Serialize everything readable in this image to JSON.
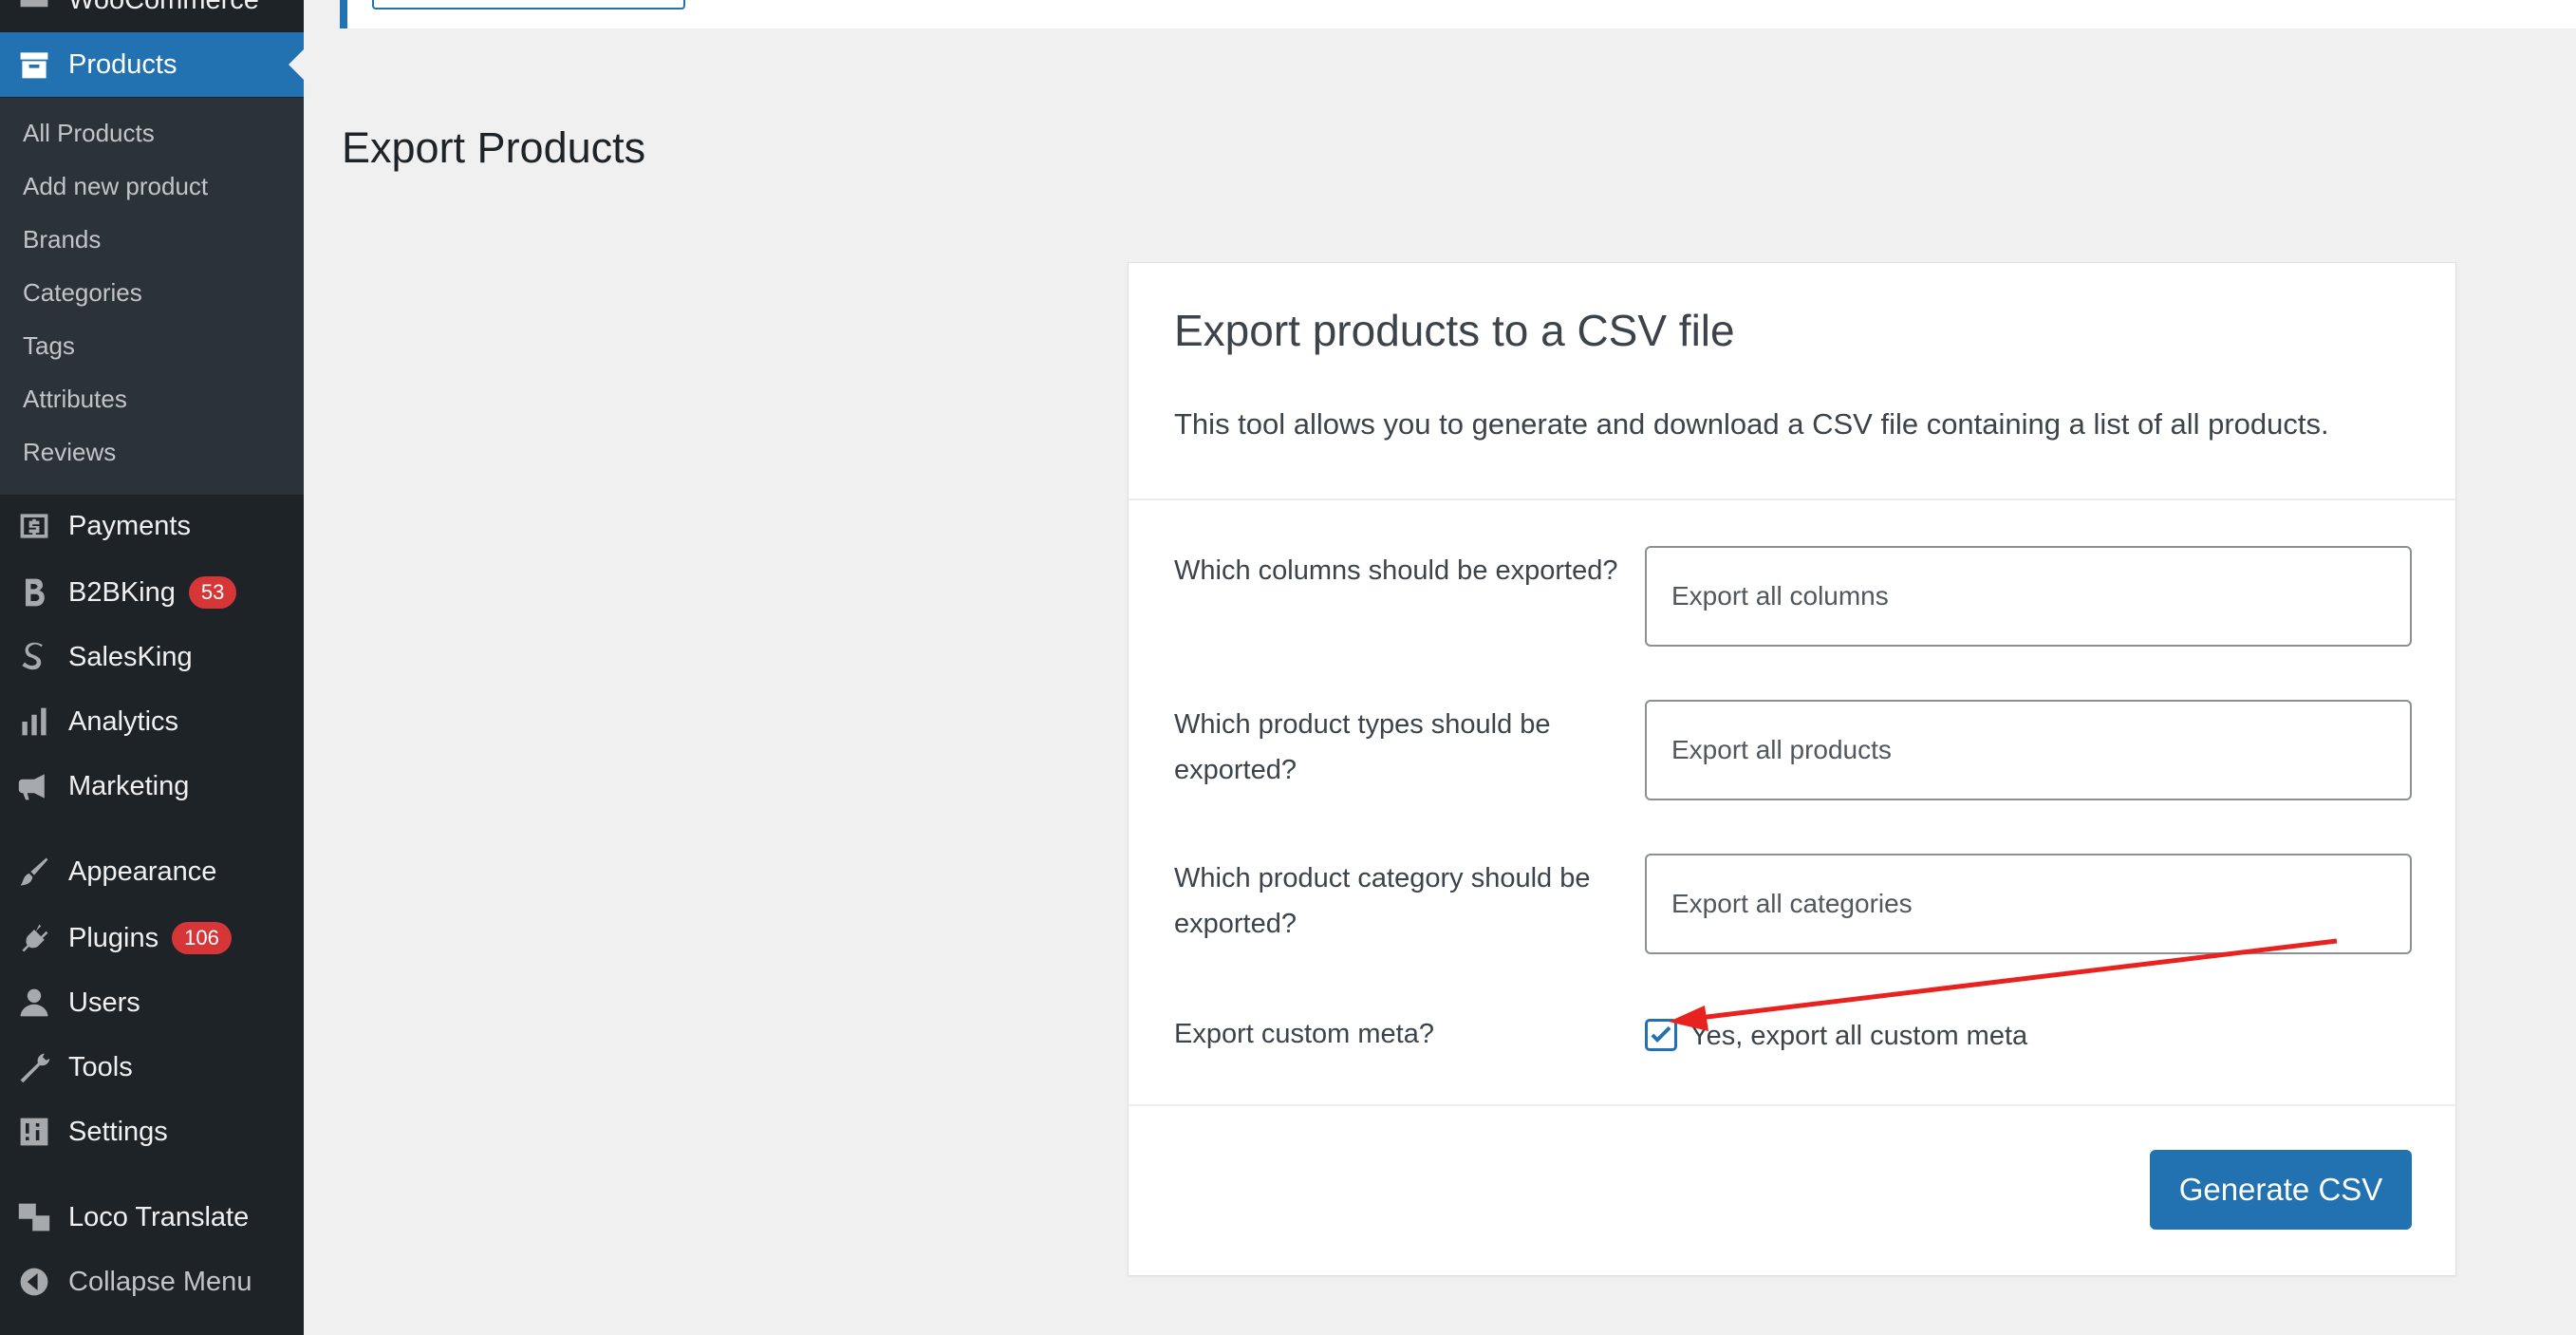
{
  "sidebar": {
    "top_cut": "WooCommerce",
    "products": "Products",
    "submenu": [
      "All Products",
      "Add new product",
      "Brands",
      "Categories",
      "Tags",
      "Attributes",
      "Reviews"
    ],
    "payments": "Payments",
    "b2bking": "B2BKing",
    "b2bking_badge": "53",
    "salesking": "SalesKing",
    "analytics": "Analytics",
    "marketing": "Marketing",
    "appearance": "Appearance",
    "plugins": "Plugins",
    "plugins_badge": "106",
    "users": "Users",
    "tools": "Tools",
    "settings": "Settings",
    "loco": "Loco Translate",
    "collapse": "Collapse Menu"
  },
  "main": {
    "page_title": "Export Products",
    "panel_title": "Export products to a CSV file",
    "panel_desc": "This tool allows you to generate and download a CSV file containing a list of all products.",
    "rows": [
      {
        "label": "Which columns should be exported?",
        "value": "Export all columns"
      },
      {
        "label": "Which product types should be exported?",
        "value": "Export all products"
      },
      {
        "label": "Which product category should be exported?",
        "value": "Export all categories"
      }
    ],
    "meta_label": "Export custom meta?",
    "meta_checkbox_label": "Yes, export all custom meta",
    "meta_checked": true,
    "generate_button": "Generate CSV"
  },
  "colors": {
    "sidebar_bg": "#1d2327",
    "submenu_bg": "#2c3338",
    "accent": "#2271b1",
    "badge": "#d63638",
    "annotation_arrow": "#e8231f"
  }
}
